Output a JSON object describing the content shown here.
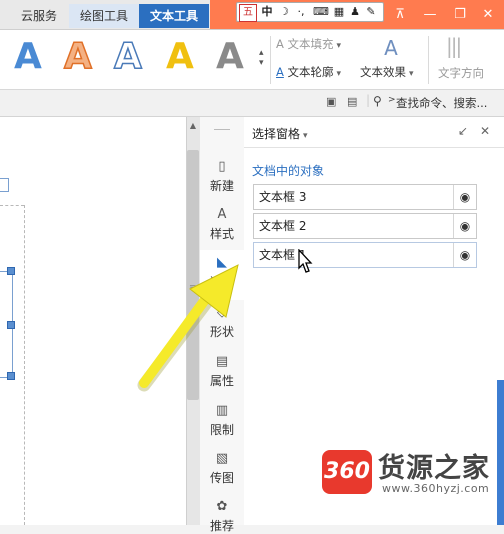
{
  "tabs": [
    {
      "label": "云服务"
    },
    {
      "label": "绘图工具"
    },
    {
      "label": "文本工具"
    }
  ],
  "ime": {
    "mode_icon": "五",
    "lang": "中",
    "punct": "·,"
  },
  "ribbon": {
    "text_fill_label": "文本填充",
    "text_outline_label": "文本轮廓",
    "text_effect_label": "文本效果",
    "text_direction_label": "文字方向",
    "style_letter": "A"
  },
  "search": {
    "placeholder": "查找命令、搜索..."
  },
  "sidebar": {
    "items": [
      {
        "label": "新建"
      },
      {
        "label": "样式"
      },
      {
        "label": "选择"
      },
      {
        "label": "形状"
      },
      {
        "label": "属性"
      },
      {
        "label": "限制"
      },
      {
        "label": "传图"
      },
      {
        "label": "推荐"
      }
    ]
  },
  "pane": {
    "title": "选择窗格",
    "section_title": "文档中的对象",
    "objects": [
      {
        "label": "文本框 3"
      },
      {
        "label": "文本框 2"
      },
      {
        "label": "文本框 1"
      }
    ]
  },
  "watermark": {
    "logo_text": "360",
    "brand": "货源之家",
    "url": "www.360hyzj.com"
  },
  "colors": {
    "accent": "#2b6fc0",
    "title_bar": "#ff7b4f",
    "arrow": "#f5ea2a"
  }
}
